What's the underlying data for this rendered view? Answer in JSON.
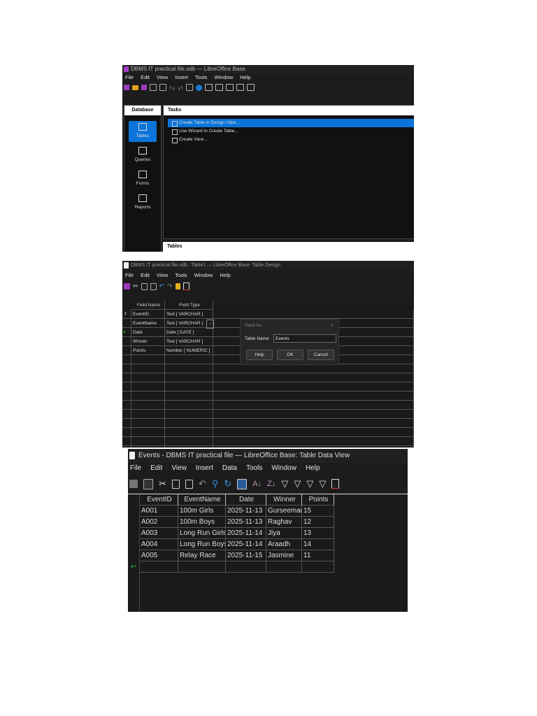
{
  "shot1": {
    "title": "DBMS IT practical file.odb — LibreOffice Base",
    "menu": [
      "File",
      "Edit",
      "View",
      "Insert",
      "Tools",
      "Window",
      "Help"
    ],
    "database_header": "Database",
    "tasks_header": "Tasks",
    "sidebar": [
      "Tables",
      "Queries",
      "Forms",
      "Reports"
    ],
    "tasks": [
      "Create Table in Design View...",
      "Use Wizard to Create Table...",
      "Create View..."
    ],
    "tables_header": "Tables",
    "accent": "#0a74da"
  },
  "shot2": {
    "title": "DBMS IT practical file.odb : Table1 — LibreOffice Base: Table Design",
    "menu": [
      "File",
      "Edit",
      "View",
      "Tools",
      "Window",
      "Help"
    ],
    "headers": [
      "Field Name",
      "Field Type"
    ],
    "rows": [
      [
        "EventID",
        "Text [ VARCHAR ]"
      ],
      [
        "EventName",
        "Text [ VARCHAR ]"
      ],
      [
        "Date",
        "Date [ DATE ]"
      ],
      [
        "Winner",
        "Text [ VARCHAR ]"
      ],
      [
        "Points",
        "Number [ NUMERIC ]"
      ]
    ],
    "dialog": {
      "title": "Save As",
      "label": "Table Name",
      "value": "Events",
      "buttons": [
        "Help",
        "OK",
        "Cancel"
      ],
      "close": "✕"
    }
  },
  "shot3": {
    "title": "Events - DBMS IT practical file — LibreOffice Base: Table Data View",
    "menu": [
      "File",
      "Edit",
      "View",
      "Insert",
      "Data",
      "Tools",
      "Window",
      "Help"
    ],
    "headers": [
      "EventID",
      "EventName",
      "Date",
      "Winner",
      "Points"
    ],
    "rows": [
      [
        "A001",
        "100m Girls",
        "2025-11-13",
        "Gurseemar",
        "15"
      ],
      [
        "A002",
        "100m Boys",
        "2025-11-13",
        "Raghav",
        "12"
      ],
      [
        "A003",
        "Long Run Girls",
        "2025-11-14",
        "Jiya",
        "13"
      ],
      [
        "A004",
        "Long Run Boys",
        "2025-11-14",
        "Araadh",
        "14"
      ],
      [
        "A005",
        "Relay Race",
        "2025-11-15",
        "Jasmine",
        "11"
      ]
    ],
    "new_row_marker": "▸+"
  }
}
